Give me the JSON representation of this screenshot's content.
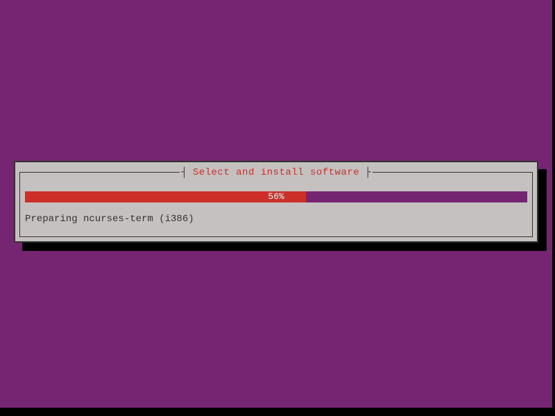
{
  "dialog": {
    "title": "Select and install software",
    "progress": {
      "percent": 56,
      "label": "56%"
    },
    "status": "Preparing ncurses-term (i386)"
  },
  "colors": {
    "background": "#762572",
    "dialog_bg": "#c5c1c1",
    "progress_fill": "#cc2f27",
    "progress_bg": "#762572",
    "title_color": "#cc2f27"
  }
}
